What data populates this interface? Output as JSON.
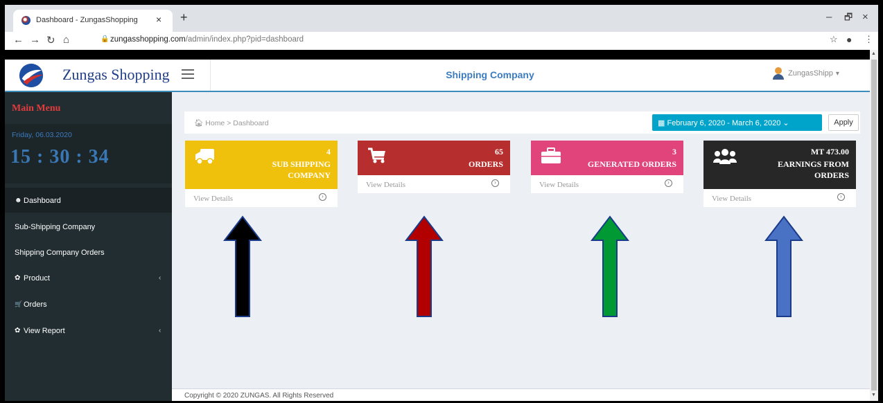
{
  "browser": {
    "tab_title": "Dashboard - ZungasShopping",
    "tab_close": "×",
    "new_tab": "+",
    "url_host": "zungasshopping.com",
    "url_path": "/admin/index.php?pid=dashboard",
    "win_min": "–",
    "win_restore": "🗗",
    "win_close": "×"
  },
  "header": {
    "logo_text": "Zungas Shopping",
    "title": "Shipping Company",
    "user_name": "ZungasShipp",
    "user_caret": "▾"
  },
  "sidebar": {
    "menu_title": "Main Menu",
    "date": "Friday, 06.03.2020",
    "time": "15 : 30 : 34",
    "items": [
      {
        "label": "Dashboard",
        "icon": "dashboard-icon",
        "glyph": "☻"
      },
      {
        "label": "Sub-Shipping Company",
        "icon": "",
        "glyph": ""
      },
      {
        "label": "Shipping Company Orders",
        "icon": "",
        "glyph": ""
      },
      {
        "label": "Product",
        "icon": "cube-icon",
        "glyph": "✿",
        "chevron": "‹"
      },
      {
        "label": "Orders",
        "icon": "cart-icon",
        "glyph": "🛒"
      },
      {
        "label": "View Report",
        "icon": "report-icon",
        "glyph": "✿",
        "chevron": "‹"
      }
    ]
  },
  "breadcrumb": {
    "home": "Home",
    "separator": ">",
    "current": "Dashboard"
  },
  "daterange": {
    "label": "February 6, 2020 - March 6, 2020",
    "caret": "⌄",
    "apply": "Apply"
  },
  "cards": [
    {
      "count": "4",
      "label_lines": [
        "SUB SHIPPING",
        "COMPANY"
      ],
      "link": "View Details",
      "color": "#f0c10c",
      "icon": "truck-icon"
    },
    {
      "count": "65",
      "label_lines": [
        "ORDERS"
      ],
      "link": "View Details",
      "color": "#b62e2e",
      "icon": "cart-icon"
    },
    {
      "count": "3",
      "label_lines": [
        "GENERATED ORDERS"
      ],
      "link": "View Details",
      "color": "#e0447a",
      "icon": "briefcase-icon"
    },
    {
      "count": "MT 473.00",
      "label_lines": [
        "EARNINGS FROM",
        "ORDERS"
      ],
      "link": "View Details",
      "color": "#272727",
      "icon": "users-icon"
    }
  ],
  "annotation_arrows": [
    {
      "color": "#000000"
    },
    {
      "color": "#b20000"
    },
    {
      "color": "#009933"
    },
    {
      "color": "#4a72c4"
    }
  ],
  "footer": {
    "text": "Copyright © 2020 ZUNGAS. All Rights Reserved"
  }
}
